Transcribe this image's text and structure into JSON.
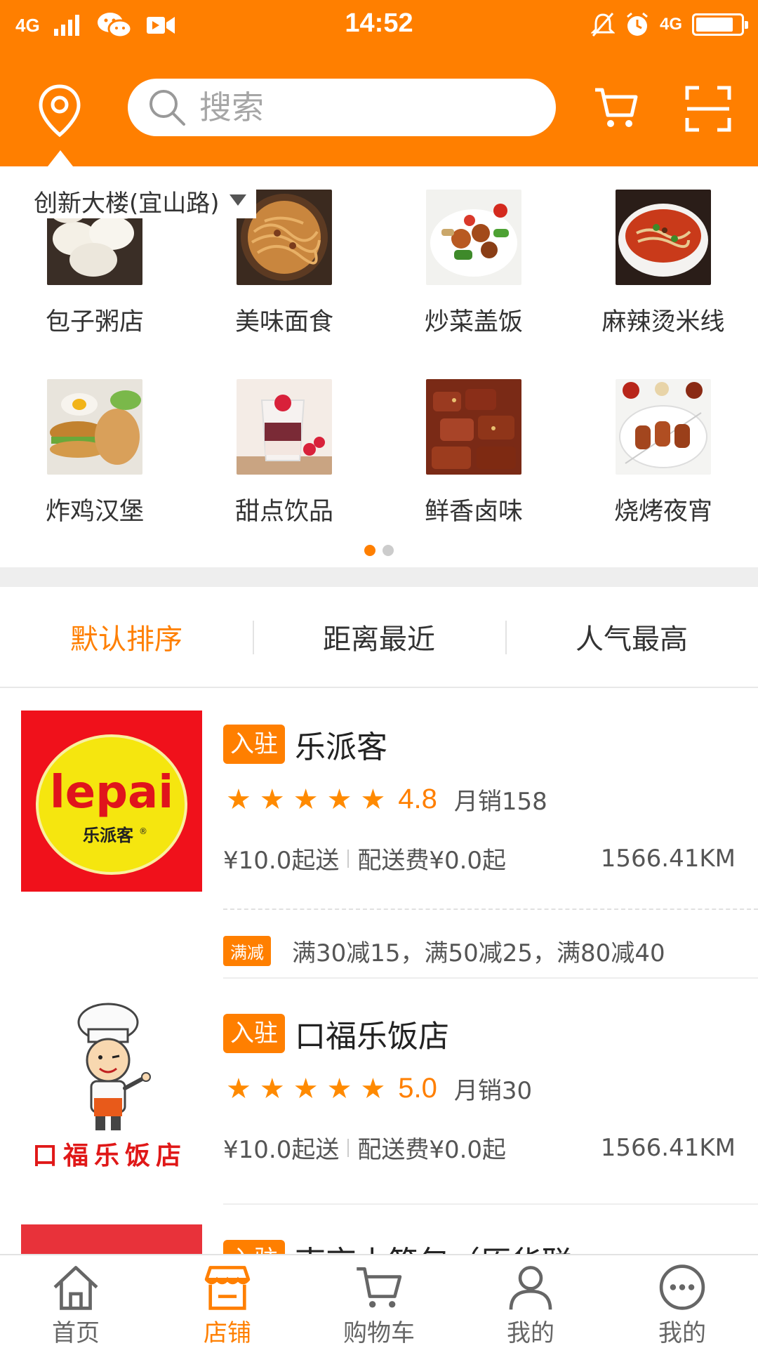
{
  "status_bar": {
    "network": "4G",
    "time": "14:52",
    "network_right": "4G"
  },
  "header": {
    "search_placeholder": "搜索",
    "location": "创新大楼(宜山路)"
  },
  "categories": [
    {
      "label": "包子粥店",
      "icon": "baozi-image"
    },
    {
      "label": "美味面食",
      "icon": "noodles-image"
    },
    {
      "label": "炒菜盖饭",
      "icon": "stirfry-image"
    },
    {
      "label": "麻辣烫米线",
      "icon": "spicy-noodle-image"
    },
    {
      "label": "炸鸡汉堡",
      "icon": "burger-image"
    },
    {
      "label": "甜点饮品",
      "icon": "dessert-image"
    },
    {
      "label": "鲜香卤味",
      "icon": "braised-meat-image"
    },
    {
      "label": "烧烤夜宵",
      "icon": "bbq-image"
    }
  ],
  "pager": {
    "pages": 2,
    "active": 1
  },
  "sort_tabs": [
    {
      "label": "默认排序",
      "active": true
    },
    {
      "label": "距离最近",
      "active": false
    },
    {
      "label": "人气最高",
      "active": false
    }
  ],
  "shops": [
    {
      "badge": "入驻",
      "name": "乐派客",
      "rating": "4.8",
      "stars": 5,
      "sales": "月销158",
      "min_order": "¥10.0起送",
      "delivery_fee": "配送费¥0.0起",
      "distance": "1566.41KM",
      "promo_badge": "满减",
      "promo_text": "满30减15，满50减25，满80减40",
      "logo_text": "lepai",
      "logo_subtext": "乐派客"
    },
    {
      "badge": "入驻",
      "name": "口福乐饭店",
      "rating": "5.0",
      "stars": 5,
      "sales": "月销30",
      "min_order": "¥10.0起送",
      "delivery_fee": "配送费¥0.0起",
      "distance": "1566.41KM",
      "logo_text": "口福乐饭店"
    },
    {
      "badge": "入驻",
      "name": "南京小笼包（原华联"
    }
  ],
  "bottom_nav": [
    {
      "label": "首页",
      "icon": "home-icon",
      "active": false
    },
    {
      "label": "店铺",
      "icon": "store-icon",
      "active": true
    },
    {
      "label": "购物车",
      "icon": "cart-icon",
      "active": false
    },
    {
      "label": "我的",
      "icon": "user-icon",
      "active": false
    },
    {
      "label": "我的",
      "icon": "more-icon",
      "active": false
    }
  ],
  "colors": {
    "brand": "#ff7f00",
    "star": "#ff8a00",
    "lepai_red": "#f0111b",
    "lepai_yellow": "#f5e60f"
  }
}
